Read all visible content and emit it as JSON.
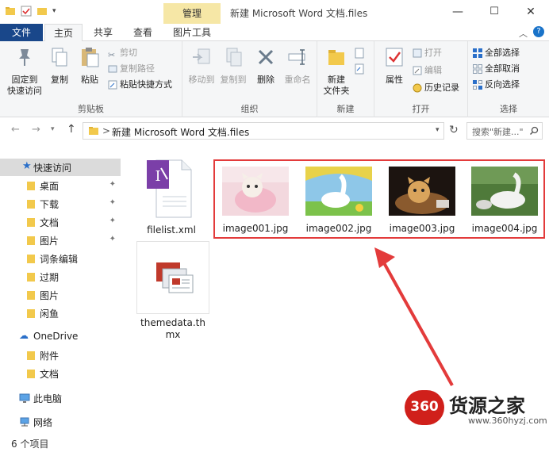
{
  "window": {
    "title": "新建 Microsoft Word 文档.files",
    "context_tab_group": "管理",
    "minimize": "—",
    "maximize": "☐",
    "close": "✕"
  },
  "tabs": {
    "file": "文件",
    "home": "主页",
    "share": "共享",
    "view": "查看",
    "picture_tools": "图片工具"
  },
  "ribbon": {
    "clipboard": {
      "pin_quick": "固定到\n快速访问",
      "copy": "复制",
      "paste": "粘贴",
      "cut": "剪切",
      "copy_path": "复制路径",
      "paste_shortcut": "粘贴快捷方式",
      "group": "剪贴板"
    },
    "organize": {
      "move_to": "移动到",
      "copy_to": "复制到",
      "delete": "删除",
      "rename": "重命名",
      "group": "组织"
    },
    "new": {
      "new_folder": "新建\n文件夹",
      "group": "新建"
    },
    "open": {
      "properties": "属性",
      "open": "打开",
      "edit": "编辑",
      "history": "历史记录",
      "group": "打开"
    },
    "select": {
      "select_all": "全部选择",
      "select_none": "全部取消",
      "invert": "反向选择",
      "group": "选择"
    }
  },
  "address": {
    "path": "新建 Microsoft Word 文档.files",
    "separator": ">",
    "search_placeholder": "搜索\"新建...\""
  },
  "nav": {
    "quick_access": "快速访问",
    "items": [
      {
        "label": "桌面",
        "pinned": true
      },
      {
        "label": "下载",
        "pinned": true
      },
      {
        "label": "文档",
        "pinned": true
      },
      {
        "label": "图片",
        "pinned": true
      },
      {
        "label": "词条编辑",
        "pinned": false
      },
      {
        "label": "过期",
        "pinned": false
      },
      {
        "label": "图片",
        "pinned": false
      },
      {
        "label": "闲鱼",
        "pinned": false
      }
    ],
    "onedrive": "OneDrive",
    "onedrive_items": [
      "附件",
      "文档"
    ],
    "this_pc": "此电脑",
    "network": "网络"
  },
  "files": [
    {
      "name": "filelist.xml",
      "type": "xml"
    },
    {
      "name": "image001.jpg",
      "type": "image"
    },
    {
      "name": "image002.jpg",
      "type": "image"
    },
    {
      "name": "image003.jpg",
      "type": "image"
    },
    {
      "name": "image004.jpg",
      "type": "image"
    },
    {
      "name": "themedata.thmx",
      "type": "thmx"
    }
  ],
  "status": {
    "item_count": "6 个项目"
  },
  "watermark": {
    "brand_number": "360",
    "brand_text": "货源之家",
    "url": "www.360hyzj.com"
  },
  "colors": {
    "file_tab": "#19478a",
    "context_tab": "#f6e7a6",
    "highlight_box": "#e33b3b",
    "arrow": "#e33b3b"
  }
}
